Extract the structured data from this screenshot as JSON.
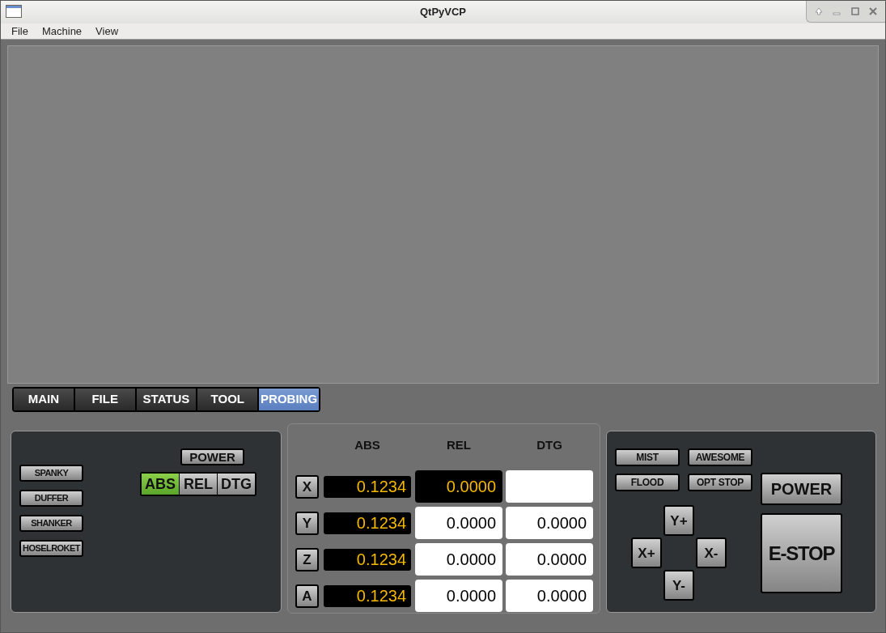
{
  "window": {
    "title": "QtPyVCP"
  },
  "menu": [
    "File",
    "Machine",
    "View"
  ],
  "tabs": [
    {
      "label": "MAIN",
      "selected": false
    },
    {
      "label": "FILE",
      "selected": false
    },
    {
      "label": "STATUS",
      "selected": false
    },
    {
      "label": "TOOL",
      "selected": false
    },
    {
      "label": "PROBING",
      "selected": true
    }
  ],
  "left_panel": {
    "buttons": [
      "SPANKY",
      "DUFFER",
      "SHANKER",
      "HOSELROKET"
    ],
    "power_button": "POWER",
    "mode_toggle": [
      {
        "label": "ABS",
        "selected": true
      },
      {
        "label": "REL",
        "selected": false
      },
      {
        "label": "DTG",
        "selected": false
      }
    ]
  },
  "dro": {
    "columns": [
      "ABS",
      "REL",
      "DTG"
    ],
    "rows": [
      {
        "axis": "X",
        "abs": "0.1234",
        "rel": "0.0000",
        "rel_selected": true
      },
      {
        "axis": "Y",
        "abs": "0.1234",
        "rel": "0.0000",
        "rel_selected": false,
        "dtg": "0.0000"
      },
      {
        "axis": "Z",
        "abs": "0.1234",
        "rel": "0.0000",
        "rel_selected": false,
        "dtg": "0.0000"
      },
      {
        "axis": "A",
        "abs": "0.1234",
        "rel": "0.0000",
        "rel_selected": false,
        "dtg": "0.0000"
      }
    ]
  },
  "right_panel": {
    "toggle_buttons": [
      "MIST",
      "AWESOME",
      "FLOOD",
      "OPT STOP"
    ],
    "power_button": "POWER",
    "estop_button": "E-STOP",
    "jog": {
      "y_plus": "Y+",
      "x_plus": "X+",
      "x_minus": "X-",
      "y_minus": "Y-"
    }
  }
}
